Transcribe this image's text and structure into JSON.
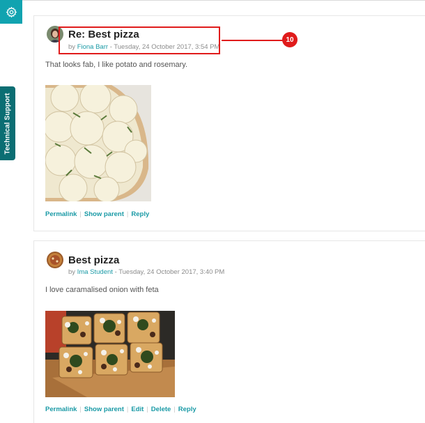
{
  "sidebar": {
    "settings_icon": "gear-icon",
    "tech_support_label": "Technical Support"
  },
  "posts": [
    {
      "subject": "Re: Best pizza",
      "by_prefix": "by",
      "author": "Fiona Barr",
      "date": "Tuesday, 24 October 2017, 3:54 PM",
      "message": "That looks fab, I like potato and rosemary.",
      "image_alt": "potato and rosemary pizza",
      "commands": [
        "Permalink",
        "Show parent",
        "Reply"
      ]
    },
    {
      "subject": "Best pizza",
      "by_prefix": "by",
      "author": "Ima Student",
      "date": "Tuesday, 24 October 2017, 3:40 PM",
      "message": "I love caramalised onion with feta",
      "image_alt": "caramelised onion and feta flatbread",
      "commands": [
        "Permalink",
        "Show parent",
        "Edit",
        "Delete",
        "Reply"
      ]
    }
  ],
  "annotation": {
    "callout_number": "10",
    "color": "#e01b1b"
  },
  "colors": {
    "accent": "#11a3b0",
    "tech_tab": "#0b6e73",
    "link": "#1a9aa6"
  }
}
